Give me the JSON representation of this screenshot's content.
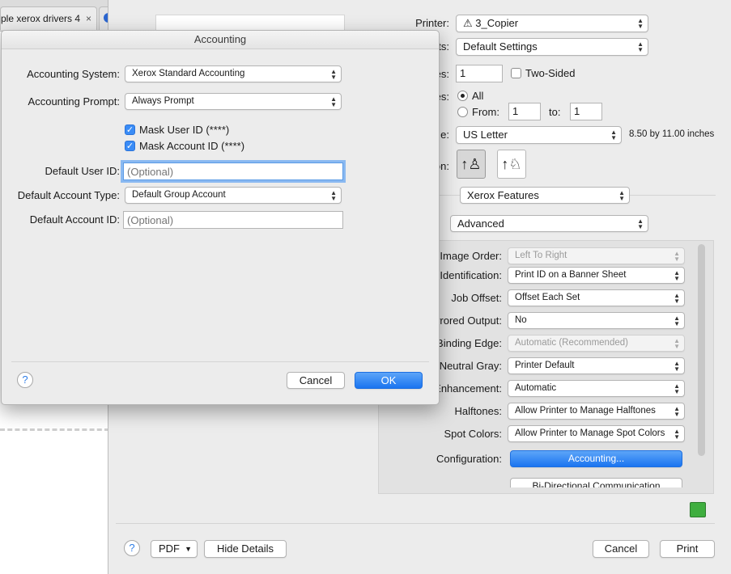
{
  "browser": {
    "tab_title": "ple xerox drivers 4",
    "tab_close": "×"
  },
  "print_dialog": {
    "printer": {
      "label": "Printer:",
      "value": "⚠ 3_Copier"
    },
    "presets": {
      "label": "ts:",
      "value": "Default Settings"
    },
    "copies": {
      "label": "es:",
      "value": "1",
      "two_sided": "Two-Sided"
    },
    "pages": {
      "label": "es:",
      "all": "All",
      "from": "From:",
      "from_value": "1",
      "to": "to:",
      "to_value": "1"
    },
    "paper_size": {
      "label": "e:",
      "value": "US Letter",
      "dims": "8.50 by 11.00 inches"
    },
    "orientation": {
      "label": "ion:"
    },
    "section_popup": "Xerox Features",
    "subsection_popup": "Advanced",
    "features": [
      {
        "label": "t Image Order:",
        "value": "Left To Right",
        "disabled": true
      },
      {
        "label": "Identification:",
        "value": "Print ID on a Banner Sheet",
        "disabled": false
      },
      {
        "label": "Job Offset:",
        "value": "Offset Each Set",
        "disabled": false
      },
      {
        "label": "rrored Output:",
        "value": "No",
        "disabled": false
      },
      {
        "label": "Binding Edge:",
        "value": "Automatic (Recommended)",
        "disabled": true
      },
      {
        "label": "Neutral Gray:",
        "value": "Printer Default",
        "disabled": false
      },
      {
        "label": "Enhancement:",
        "value": "Automatic",
        "disabled": false
      },
      {
        "label": "Halftones:",
        "value": "Allow Printer to Manage Halftones",
        "disabled": false
      },
      {
        "label": "Spot Colors:",
        "value": "Allow Printer to Manage Spot Colors",
        "disabled": false
      }
    ],
    "configuration": {
      "label": "Configuration:",
      "button": "Accounting...",
      "next_button": "Bi-Directional Communication"
    },
    "footer": {
      "help": "?",
      "pdf": "PDF",
      "hide_details": "Hide Details",
      "cancel": "Cancel",
      "print": "Print"
    }
  },
  "accounting": {
    "title": "Accounting",
    "system": {
      "label": "Accounting System:",
      "value": "Xerox Standard Accounting"
    },
    "prompt": {
      "label": "Accounting Prompt:",
      "value": "Always Prompt"
    },
    "mask_user": "Mask User ID (****)",
    "mask_account": "Mask Account ID (****)",
    "default_user": {
      "label": "Default User ID:",
      "placeholder": "(Optional)"
    },
    "default_account_type": {
      "label": "Default Account Type:",
      "value": "Default Group Account"
    },
    "default_account": {
      "label": "Default Account ID:",
      "placeholder": "(Optional)"
    },
    "help": "?",
    "cancel": "Cancel",
    "ok": "OK"
  },
  "colors": {
    "accent": "#1a74f0",
    "status_icon": "#3fae3f"
  },
  "icons": [
    "close-icon",
    "warning-icon",
    "portrait-orientation-icon",
    "landscape-orientation-icon",
    "help-icon",
    "check-icon",
    "popup-arrows-icon",
    "status-icon"
  ]
}
